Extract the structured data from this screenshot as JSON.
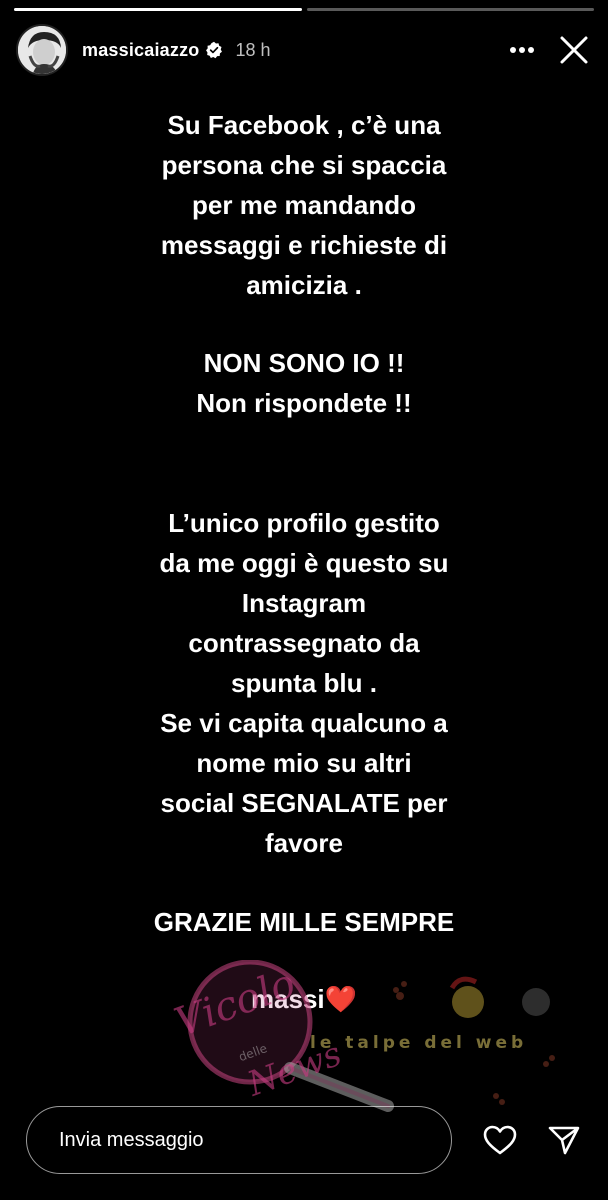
{
  "story": {
    "segments": [
      1,
      0
    ],
    "user": {
      "username": "massicaiazzo",
      "verified": true,
      "time_ago": "18 h"
    },
    "paragraphs": [
      [
        "Su Facebook , c’è una",
        "persona che si spaccia",
        "per me mandando",
        "messaggi e richieste di",
        "amicizia ."
      ],
      [
        "NON SONO IO !!",
        "Non rispondete !!"
      ],
      [
        "L’unico profilo gestito",
        "da me oggi è questo su",
        "Instagram",
        "contrassegnato da",
        "spunta blu .",
        "Se vi capita qualcuno a",
        "nome mio su altri",
        "social SEGNALATE per",
        "favore"
      ],
      [
        "GRAZIE MILLE SEMPRE"
      ]
    ],
    "signature": "massi❤️",
    "watermarks": {
      "left": "Vicolo delle News",
      "right": "le talpe del web"
    }
  },
  "composer": {
    "placeholder": "Invia messaggio"
  },
  "colors": {
    "background": "#000000",
    "text": "#ffffff",
    "verified_badge": "#ffffff"
  }
}
